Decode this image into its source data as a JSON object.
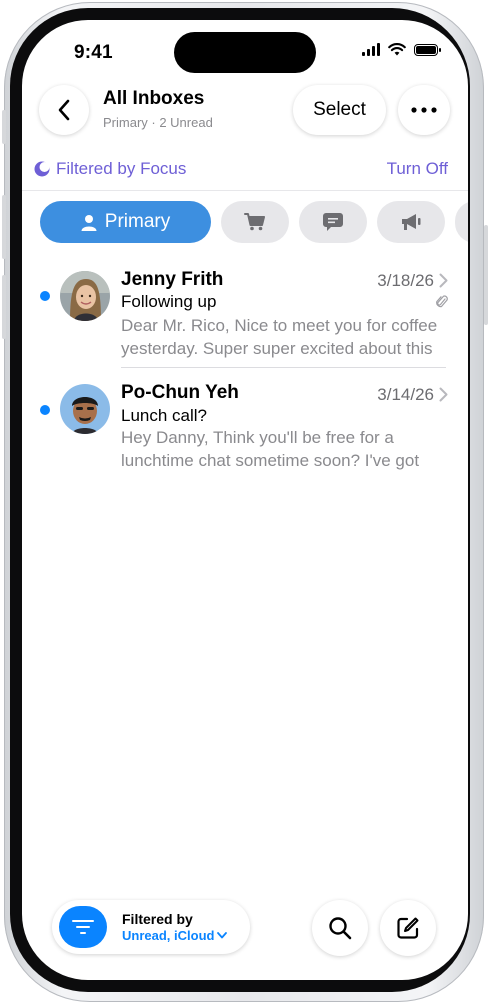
{
  "status_bar": {
    "time": "9:41"
  },
  "header": {
    "title": "All Inboxes",
    "subtitle": "Primary · 2 Unread",
    "select_label": "Select"
  },
  "focus": {
    "label": "Filtered by Focus",
    "action": "Turn Off",
    "accent_color": "#6e5fd6"
  },
  "categories": [
    {
      "label": "Primary",
      "icon": "person-icon",
      "selected": true
    },
    {
      "label": "",
      "icon": "cart-icon"
    },
    {
      "label": "",
      "icon": "chat-bubble-icon"
    },
    {
      "label": "",
      "icon": "megaphone-icon"
    }
  ],
  "messages": [
    {
      "sender": "Jenny Frith",
      "date": "3/18/26",
      "subject": "Following up",
      "preview": "Dear Mr. Rico, Nice to meet you for coffee yesterday. Super super excited about this",
      "unread": true,
      "has_attachment": true
    },
    {
      "sender": "Po-Chun Yeh",
      "date": "3/14/26",
      "subject": "Lunch call?",
      "preview": "Hey Danny, Think you'll be free for a lunchtime chat sometime soon? I've got",
      "unread": true,
      "has_attachment": false
    }
  ],
  "toolbar": {
    "filter_title": "Filtered by",
    "filter_value": "Unread, iCloud"
  },
  "colors": {
    "accent": "#0a84ff",
    "primary_tab": "#3d8fe0"
  }
}
